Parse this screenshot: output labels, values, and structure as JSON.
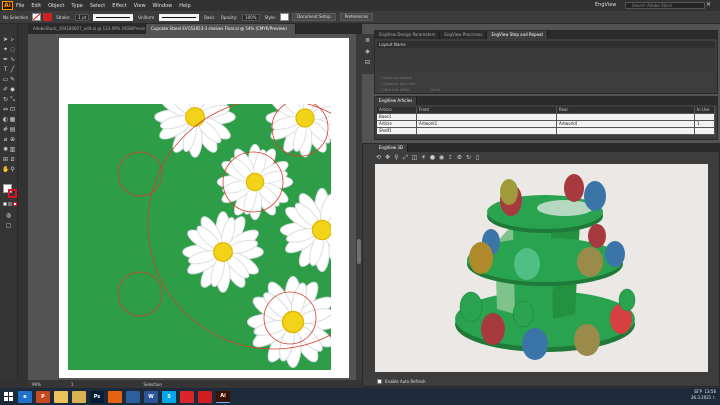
{
  "menubar": {
    "app_logo": "Ai",
    "items": [
      "File",
      "Edit",
      "Object",
      "Type",
      "Select",
      "Effect",
      "View",
      "Window",
      "Help"
    ],
    "workspace": "EngView",
    "search_placeholder": "Search Adobe Stock"
  },
  "controlbar": {
    "selection": "No Selection",
    "stroke_label": "Stroke:",
    "stroke_value": "1 pt",
    "stroke_style": "Uniform",
    "brush_label": "Basic",
    "opacity_label": "Opacity:",
    "opacity_value": "100%",
    "style_label": "Style:",
    "document_setup": "Document Setup",
    "preferences": "Preferences"
  },
  "document_tabs": [
    {
      "label": "AdobeStock_194180607_edit.ai @ 123.09% (RGB/Preview)",
      "active": false
    },
    {
      "label": "Cupcake Stand EVC62853-3 shelves Final.ai @ 54% (CMYK/Preview)",
      "active": true
    }
  ],
  "statusbar": {
    "zoom": "99%",
    "page": "1",
    "tool": "Selection"
  },
  "panels": {
    "top_tabs": [
      "EngView Design Parameters",
      "EngView Processes",
      "EngView Step and Repeat"
    ],
    "layout_name_label": "Layout Name",
    "article_panel_title": "EngView Articles",
    "article_columns": [
      "Article",
      "Front",
      "Rear",
      "In Use"
    ],
    "article_rows": [
      {
        "article": "Base1",
        "front": "",
        "rear": "",
        "in_use": ""
      },
      {
        "article": "Article",
        "front": "Artwork1",
        "rear": "Artwork4",
        "in_use": "1"
      },
      {
        "article": "Shelf1",
        "front": "",
        "rear": "",
        "in_use": ""
      }
    ],
    "viewer_title": "EngView 3D",
    "auto_refresh_label": "Enable Auto Refresh",
    "options": [
      "Nests by default",
      "Distance from fold",
      "Nest min offset"
    ],
    "options_value": "0mm"
  },
  "taskbar": {
    "time": "13:56",
    "date": "26.3.2021 г.",
    "lang": "БГР",
    "apps": [
      {
        "name": "edge",
        "label": "e",
        "color": "#1e73c8"
      },
      {
        "name": "powerpoint",
        "label": "P",
        "color": "#c74a1f"
      },
      {
        "name": "files",
        "label": "",
        "color": "#e9c35a"
      },
      {
        "name": "explorer",
        "label": "",
        "color": "#d9b150"
      },
      {
        "name": "photoshop",
        "label": "Ps",
        "color": "#001d34"
      },
      {
        "name": "firefox",
        "label": "",
        "color": "#e3630f"
      },
      {
        "name": "store",
        "label": "",
        "color": "#2b5f9e"
      },
      {
        "name": "word",
        "label": "W",
        "color": "#2b579a"
      },
      {
        "name": "skype",
        "label": "S",
        "color": "#00a8e6"
      },
      {
        "name": "record",
        "label": "",
        "color": "#d8262b"
      },
      {
        "name": "acrobat",
        "label": "",
        "color": "#d01e1e"
      },
      {
        "name": "illustrator",
        "label": "Ai",
        "color": "#3a1300"
      }
    ]
  },
  "colors": {
    "artwork_green": "#2d9e47",
    "stand_green": "#2aa350",
    "accent_yellow": "#f3d31a"
  }
}
